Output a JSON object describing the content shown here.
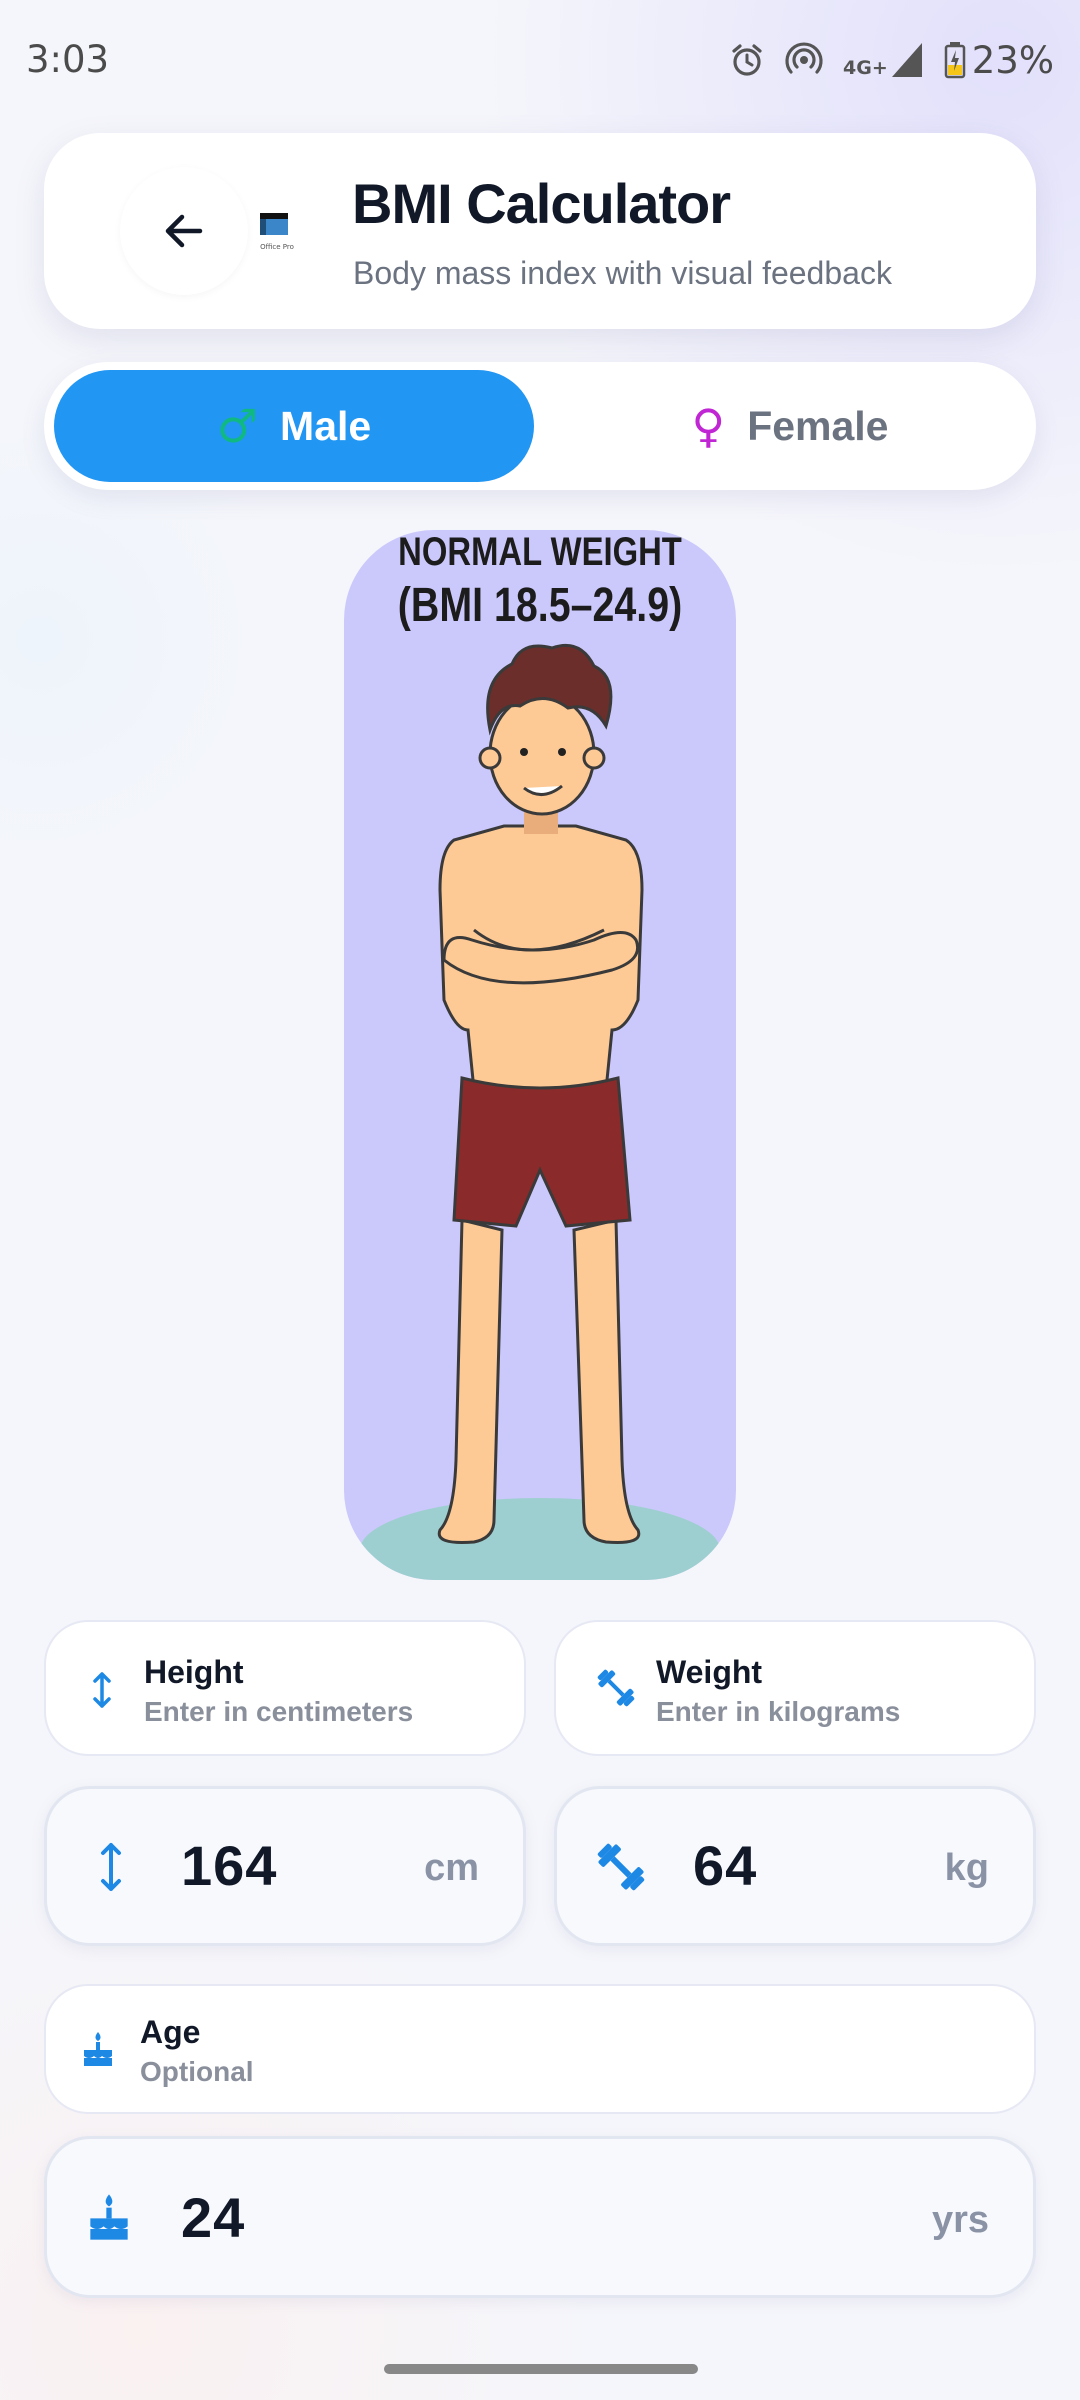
{
  "status_bar": {
    "time": "3:03",
    "network": "4G+",
    "battery": "23%",
    "icons": [
      "alarm-icon",
      "hotspot-icon",
      "signal-icon",
      "battery-charging-icon"
    ]
  },
  "header": {
    "back_icon": "arrow-left-icon",
    "app_icon": "app-logo",
    "app_icon_text": "Office Pro",
    "title": "BMI Calculator",
    "subtitle": "Body mass index with visual feedback"
  },
  "gender": {
    "selected": "Male",
    "options": [
      {
        "label": "Male",
        "symbol": "♂",
        "icon": "male-icon",
        "symbol_color": "#10b981"
      },
      {
        "label": "Female",
        "symbol": "♀",
        "icon": "female-icon",
        "symbol_color": "#c026d3"
      }
    ]
  },
  "illustration": {
    "label_line1": "NORMAL WEIGHT",
    "label_line2": "(BMI 18.5–24.9)"
  },
  "height": {
    "title": "Height",
    "hint": "Enter in centimeters",
    "value": "164",
    "unit": "cm",
    "icon": "height-arrows-icon"
  },
  "weight": {
    "title": "Weight",
    "hint": "Enter in kilograms",
    "value": "64",
    "unit": "kg",
    "icon": "dumbbell-icon"
  },
  "age": {
    "title": "Age",
    "hint": "Optional",
    "value": "24",
    "unit": "yrs",
    "icon": "cake-icon"
  },
  "colors": {
    "accent": "#2196f3",
    "icon_blue": "#1e88e5",
    "figure_bg": "#cbc8fb"
  }
}
